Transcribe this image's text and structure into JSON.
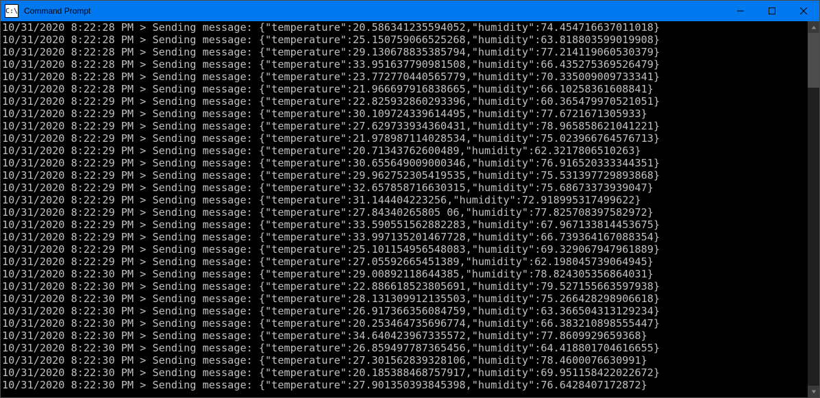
{
  "window": {
    "icon_text": "C:\\",
    "title": "Command Prompt"
  },
  "lines": [
    {
      "ts": "10/31/2020 8:22:28 PM",
      "temp": "20.586341235594052",
      "hum": "74.454716637011018"
    },
    {
      "ts": "10/31/2020 8:22:28 PM",
      "temp": "25.150759066525268",
      "hum": "63.818803599019908"
    },
    {
      "ts": "10/31/2020 8:22:28 PM",
      "temp": "29.130678835385794",
      "hum": "77.214119060530379"
    },
    {
      "ts": "10/31/2020 8:22:28 PM",
      "temp": "33.951637790981508",
      "hum": "66.435275369526479"
    },
    {
      "ts": "10/31/2020 8:22:28 PM",
      "temp": "23.772770440565779",
      "hum": "70.335009009733341"
    },
    {
      "ts": "10/31/2020 8:22:28 PM",
      "temp": "21.966697916838665",
      "hum": "66.10258361608841"
    },
    {
      "ts": "10/31/2020 8:22:29 PM",
      "temp": "22.825932860293396",
      "hum": "60.365479970521051"
    },
    {
      "ts": "10/31/2020 8:22:29 PM",
      "temp": "30.109724339614495",
      "hum": "77.6721671305933"
    },
    {
      "ts": "10/31/2020 8:22:29 PM",
      "temp": "27.629733934360431",
      "hum": "78.965858621041221"
    },
    {
      "ts": "10/31/2020 8:22:29 PM",
      "temp": "21.978987114028534",
      "hum": "75.023966764576713"
    },
    {
      "ts": "10/31/2020 8:22:29 PM",
      "temp": "20.71343762600489",
      "hum": "62.32178065 10263"
    },
    {
      "ts": "10/31/2020 8:22:29 PM",
      "temp": "30.655649009000346",
      "hum": "76.916520333344351"
    },
    {
      "ts": "10/31/2020 8:22:29 PM",
      "temp": "29.962752305419535",
      "hum": "75.531397729893868"
    },
    {
      "ts": "10/31/2020 8:22:29 PM",
      "temp": "32.657858716630315",
      "hum": "75.68673373939047"
    },
    {
      "ts": "10/31/2020 8:22:29 PM",
      "temp": "31.144404223256",
      "hum": "72.918995317499622"
    },
    {
      "ts": "10/31/2020 8:22:29 PM",
      "temp": "27.84340265805 06",
      "hum": "77.825708397582972"
    },
    {
      "ts": "10/31/2020 8:22:29 PM",
      "temp": "33.590551562882283",
      "hum": "67.967133814453675"
    },
    {
      "ts": "10/31/2020 8:22:29 PM",
      "temp": "33.997135201467728",
      "hum": "66.739364167088354"
    },
    {
      "ts": "10/31/2020 8:22:29 PM",
      "temp": "25.101154956548083",
      "hum": "69.329067947961889"
    },
    {
      "ts": "10/31/2020 8:22:29 PM",
      "temp": "27.05592665451389",
      "hum": "62.198045739064945"
    },
    {
      "ts": "10/31/2020 8:22:30 PM",
      "temp": "29.00892118644385",
      "hum": "78.824305356864031"
    },
    {
      "ts": "10/31/2020 8:22:30 PM",
      "temp": "22.886618523805691",
      "hum": "79.527155663597938"
    },
    {
      "ts": "10/31/2020 8:22:30 PM",
      "temp": "28.131309912135503",
      "hum": "75.266428298906618"
    },
    {
      "ts": "10/31/2020 8:22:30 PM",
      "temp": "26.917366356084759",
      "hum": "63.366504313129234"
    },
    {
      "ts": "10/31/2020 8:22:30 PM",
      "temp": "20.253464735696774",
      "hum": "66.383210898555447"
    },
    {
      "ts": "10/31/2020 8:22:30 PM",
      "temp": "34.640423967335572",
      "hum": "77.86099296 59368"
    },
    {
      "ts": "10/31/2020 8:22:30 PM",
      "temp": "26.859497787365456",
      "hum": "64.418801704616655"
    },
    {
      "ts": "10/31/2020 8:22:30 PM",
      "temp": "27.301562839328106",
      "hum": "78.46000766 30991"
    },
    {
      "ts": "10/31/2020 8:22:30 PM",
      "temp": "20.185388468757917",
      "hum": "69.951158422022672"
    },
    {
      "ts": "10/31/2020 8:22:30 PM",
      "temp": "27.901350393845398",
      "hum": "76.64284071 72872"
    }
  ],
  "template": {
    "prefix_sep": " > ",
    "action": "Sending message: ",
    "json_open": "{\"temperature\":",
    "json_mid": ",\"humidity\":",
    "json_close": "}"
  }
}
